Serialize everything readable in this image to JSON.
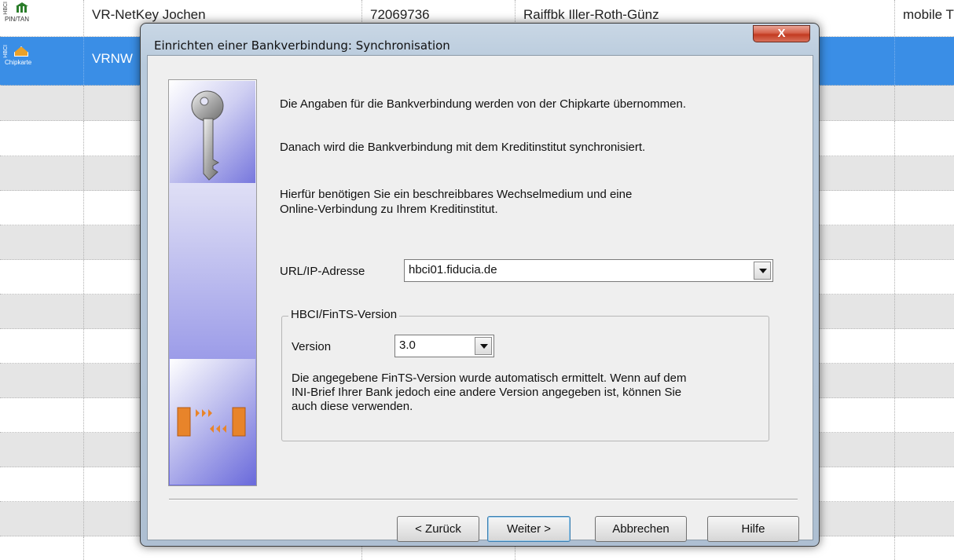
{
  "grid": {
    "rows": [
      {
        "type_side": "HBCI",
        "type_label": "PIN/TAN",
        "name": "VR-NetKey Jochen",
        "blz": "72069736",
        "bank": "Raiffbk Iller-Roth-Günz",
        "extra": "mobile T"
      },
      {
        "type_side": "HBCI",
        "type_label": "Chipkarte",
        "name": "VRNW",
        "blz": "",
        "bank": "",
        "extra": ""
      }
    ]
  },
  "dialog": {
    "title": "Einrichten einer Bankverbindung: Synchronisation",
    "close_label": "X",
    "intro_1": "Die Angaben für die Bankverbindung werden von der Chipkarte übernommen.",
    "intro_2": "Danach wird die Bankverbindung mit dem Kreditinstitut synchronisiert.",
    "intro_3a": "Hierfür benötigen Sie ein beschreibbares Wechselmedium und eine",
    "intro_3b": "Online-Verbindung zu Ihrem Kreditinstitut.",
    "url_label": "URL/IP-Adresse",
    "url_value": "hbci01.fiducia.de",
    "group_title": "HBCI/FinTS-Version",
    "version_label": "Version",
    "version_value": "3.0",
    "version_note_1": "Die angegebene FinTS-Version wurde automatisch ermittelt. Wenn auf dem",
    "version_note_2": "INI-Brief Ihrer Bank jedoch eine andere Version angegeben ist, können Sie",
    "version_note_3": "auch diese verwenden.",
    "buttons": {
      "back": "< Zurück",
      "next": "Weiter >",
      "cancel": "Abbrechen",
      "help": "Hilfe"
    }
  },
  "colors": {
    "selection": "#3a8ee6",
    "close_button": "#c23a21",
    "banner_blue": "#6e6ee0",
    "transfer_orange": "#e8842a"
  },
  "icons": {
    "row1": "bank-building-icon",
    "row2": "chipcard-icon",
    "banner_top": "key-icon",
    "banner_bottom": "sync-transfer-icon"
  }
}
